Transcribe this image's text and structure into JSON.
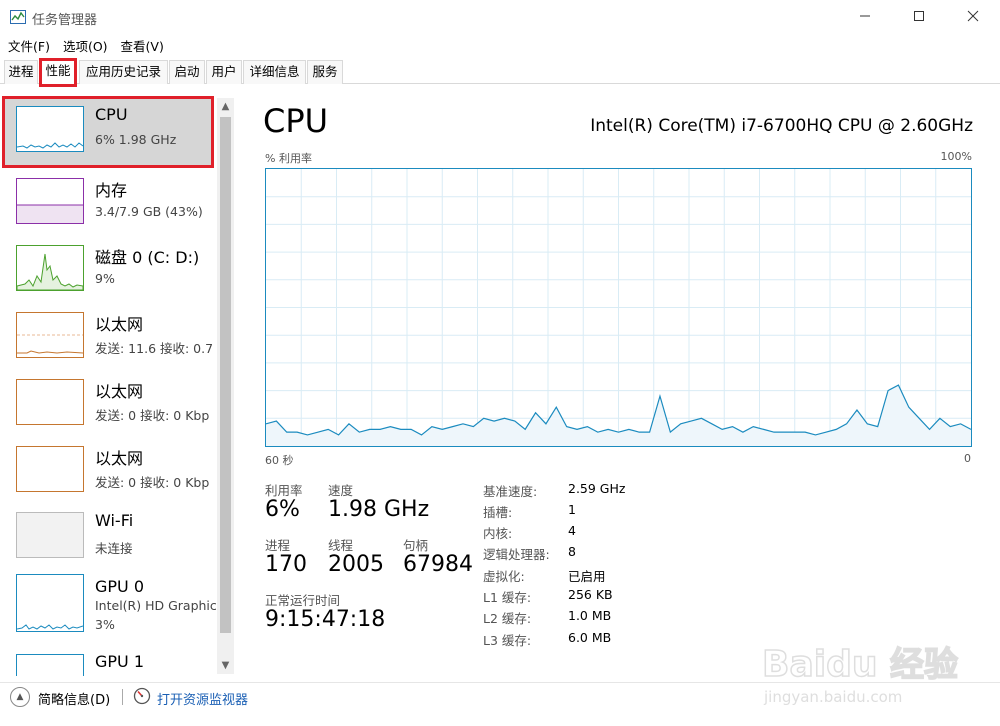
{
  "window": {
    "title": "任务管理器"
  },
  "menu": {
    "file": "文件(F)",
    "options": "选项(O)",
    "view": "查看(V)"
  },
  "tabs": [
    "进程",
    "性能",
    "应用历史记录",
    "启动",
    "用户",
    "详细信息",
    "服务"
  ],
  "sidebar": {
    "items": [
      {
        "title": "CPU",
        "sub": "6% 1.98 GHz",
        "color": "#1b8bbf",
        "selected": true
      },
      {
        "title": "内存",
        "sub": "3.4/7.9 GB (43%)",
        "color": "#8b2fa8"
      },
      {
        "title": "磁盘 0 (C: D:)",
        "sub": "9%",
        "color": "#4ca12e"
      },
      {
        "title": "以太网",
        "sub": "发送: 11.6 接收: 0.7",
        "color": "#c5762f"
      },
      {
        "title": "以太网",
        "sub": "发送: 0 接收: 0 Kbp",
        "color": "#c5762f"
      },
      {
        "title": "以太网",
        "sub": "发送: 0 接收: 0 Kbp",
        "color": "#c5762f"
      },
      {
        "title": "Wi-Fi",
        "sub": "未连接",
        "color": "#aaaaaa"
      },
      {
        "title": "GPU 0",
        "sub": "Intel(R) HD Graphic",
        "sub2": "3%",
        "color": "#1b8bbf"
      },
      {
        "title": "GPU 1",
        "sub": "",
        "color": "#1b8bbf"
      }
    ]
  },
  "main": {
    "title": "CPU",
    "model": "Intel(R) Core(TM) i7-6700HQ CPU @ 2.60GHz",
    "y_label": "% 利用率",
    "y_max": "100%",
    "x_left": "60 秒",
    "x_right": "0",
    "stats": {
      "util_label": "利用率",
      "util_value": "6%",
      "speed_label": "速度",
      "speed_value": "1.98 GHz",
      "proc_label": "进程",
      "proc_value": "170",
      "threads_label": "线程",
      "threads_value": "2005",
      "handles_label": "句柄",
      "handles_value": "67984",
      "uptime_label": "正常运行时间",
      "uptime_value": "9:15:47:18"
    },
    "info": [
      {
        "label": "基准速度:",
        "value": "2.59 GHz"
      },
      {
        "label": "插槽:",
        "value": "1"
      },
      {
        "label": "内核:",
        "value": "4"
      },
      {
        "label": "逻辑处理器:",
        "value": "8"
      },
      {
        "label": "虚拟化:",
        "value": "已启用"
      },
      {
        "label": "L1 缓存:",
        "value": "256 KB"
      },
      {
        "label": "L2 缓存:",
        "value": "1.0 MB"
      },
      {
        "label": "L3 缓存:",
        "value": "6.0 MB"
      }
    ]
  },
  "footer": {
    "fewer_details": "简略信息(D)",
    "resource_monitor": "打开资源监视器"
  },
  "watermark": {
    "brand": "Baidu",
    "brand_cn": "经验",
    "url": "jingyan.baidu.com"
  },
  "cpu_history": [
    8,
    9,
    5,
    5,
    4,
    5,
    6,
    4,
    8,
    5,
    6,
    6,
    7,
    6,
    6,
    4,
    7,
    6,
    7,
    8,
    7,
    10,
    9,
    10,
    9,
    6,
    12,
    8,
    14,
    7,
    6,
    7,
    5,
    6,
    5,
    6,
    5,
    5,
    18,
    5,
    8,
    9,
    10,
    8,
    6,
    7,
    5,
    7,
    6,
    5,
    5,
    5,
    5,
    4,
    5,
    6,
    8,
    13,
    8,
    7,
    20,
    22,
    14,
    10,
    6,
    10,
    7,
    8,
    6
  ]
}
